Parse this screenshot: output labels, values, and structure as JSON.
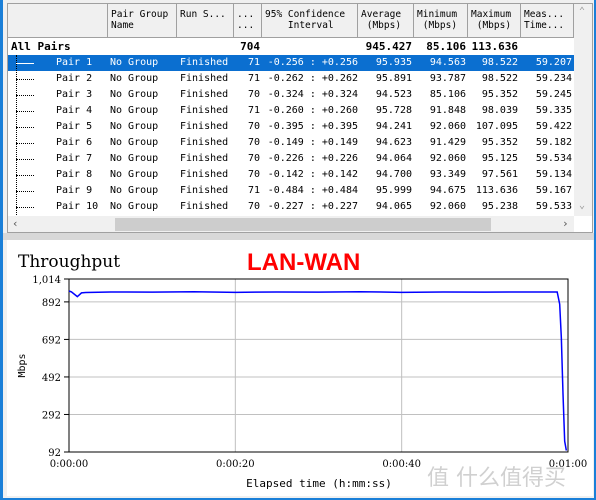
{
  "table": {
    "columns": [
      "",
      "Pair Group\nName",
      "Run S...",
      "...\n...",
      "95% Confidence\n    Interval",
      "Average\n (Mbps)",
      "Minimum\n (Mbps)",
      "Maximum\n (Mbps)",
      "Meas...\nTime..."
    ],
    "summary": {
      "label": "All Pairs",
      "count": "704",
      "average": "945.427",
      "minimum": "85.106",
      "maximum": "113.636"
    },
    "rows": [
      {
        "pair": "Pair 1",
        "group": "No Group",
        "status": "Finished",
        "n": "71",
        "ci": "-0.256 : +0.256",
        "avg": "95.935",
        "min": "94.563",
        "max": "98.522",
        "time": "59.207",
        "selected": true
      },
      {
        "pair": "Pair 2",
        "group": "No Group",
        "status": "Finished",
        "n": "71",
        "ci": "-0.262 : +0.262",
        "avg": "95.891",
        "min": "93.787",
        "max": "98.522",
        "time": "59.234"
      },
      {
        "pair": "Pair 3",
        "group": "No Group",
        "status": "Finished",
        "n": "70",
        "ci": "-0.324 : +0.324",
        "avg": "94.523",
        "min": "85.106",
        "max": "95.352",
        "time": "59.245"
      },
      {
        "pair": "Pair 4",
        "group": "No Group",
        "status": "Finished",
        "n": "71",
        "ci": "-0.260 : +0.260",
        "avg": "95.728",
        "min": "91.848",
        "max": "98.039",
        "time": "59.335"
      },
      {
        "pair": "Pair 5",
        "group": "No Group",
        "status": "Finished",
        "n": "70",
        "ci": "-0.395 : +0.395",
        "avg": "94.241",
        "min": "92.060",
        "max": "107.095",
        "time": "59.422"
      },
      {
        "pair": "Pair 6",
        "group": "No Group",
        "status": "Finished",
        "n": "70",
        "ci": "-0.149 : +0.149",
        "avg": "94.623",
        "min": "91.429",
        "max": "95.352",
        "time": "59.182"
      },
      {
        "pair": "Pair 7",
        "group": "No Group",
        "status": "Finished",
        "n": "70",
        "ci": "-0.226 : +0.226",
        "avg": "94.064",
        "min": "92.060",
        "max": "95.125",
        "time": "59.534"
      },
      {
        "pair": "Pair 8",
        "group": "No Group",
        "status": "Finished",
        "n": "70",
        "ci": "-0.142 : +0.142",
        "avg": "94.700",
        "min": "93.349",
        "max": "97.561",
        "time": "59.134"
      },
      {
        "pair": "Pair 9",
        "group": "No Group",
        "status": "Finished",
        "n": "71",
        "ci": "-0.484 : +0.484",
        "avg": "95.999",
        "min": "94.675",
        "max": "113.636",
        "time": "59.167"
      },
      {
        "pair": "Pair 10",
        "group": "No Group",
        "status": "Finished",
        "n": "70",
        "ci": "-0.227 : +0.227",
        "avg": "94.065",
        "min": "92.060",
        "max": "95.238",
        "time": "59.533"
      }
    ]
  },
  "chart_data": {
    "type": "line",
    "title": "Throughput",
    "annotation": "LAN-WAN",
    "annotation_color": "#ff0000",
    "line_color": "#0000ff",
    "xlabel": "Elapsed time (h:mm:ss)",
    "ylabel": "Mbps",
    "xticks": [
      "0:00:00",
      "0:00:20",
      "0:00:40",
      "0:01:00"
    ],
    "xlim": [
      0,
      60
    ],
    "yticks": [
      "1,014",
      "892",
      "692",
      "492",
      "292",
      "92"
    ],
    "ylim": [
      92,
      1014
    ],
    "grid": true,
    "series": [
      {
        "x": [
          0,
          0.3,
          1,
          1.5,
          2,
          5,
          10,
          15,
          20,
          25,
          30,
          35,
          40,
          45,
          50,
          55,
          58.7,
          59,
          59.2,
          59.4,
          59.6,
          59.8
        ],
        "y": [
          950,
          945,
          920,
          940,
          942,
          945,
          944,
          946,
          943,
          945,
          944,
          946,
          943,
          945,
          944,
          945,
          945,
          880,
          700,
          400,
          150,
          100
        ]
      }
    ]
  },
  "watermark": "值 什么值得买"
}
